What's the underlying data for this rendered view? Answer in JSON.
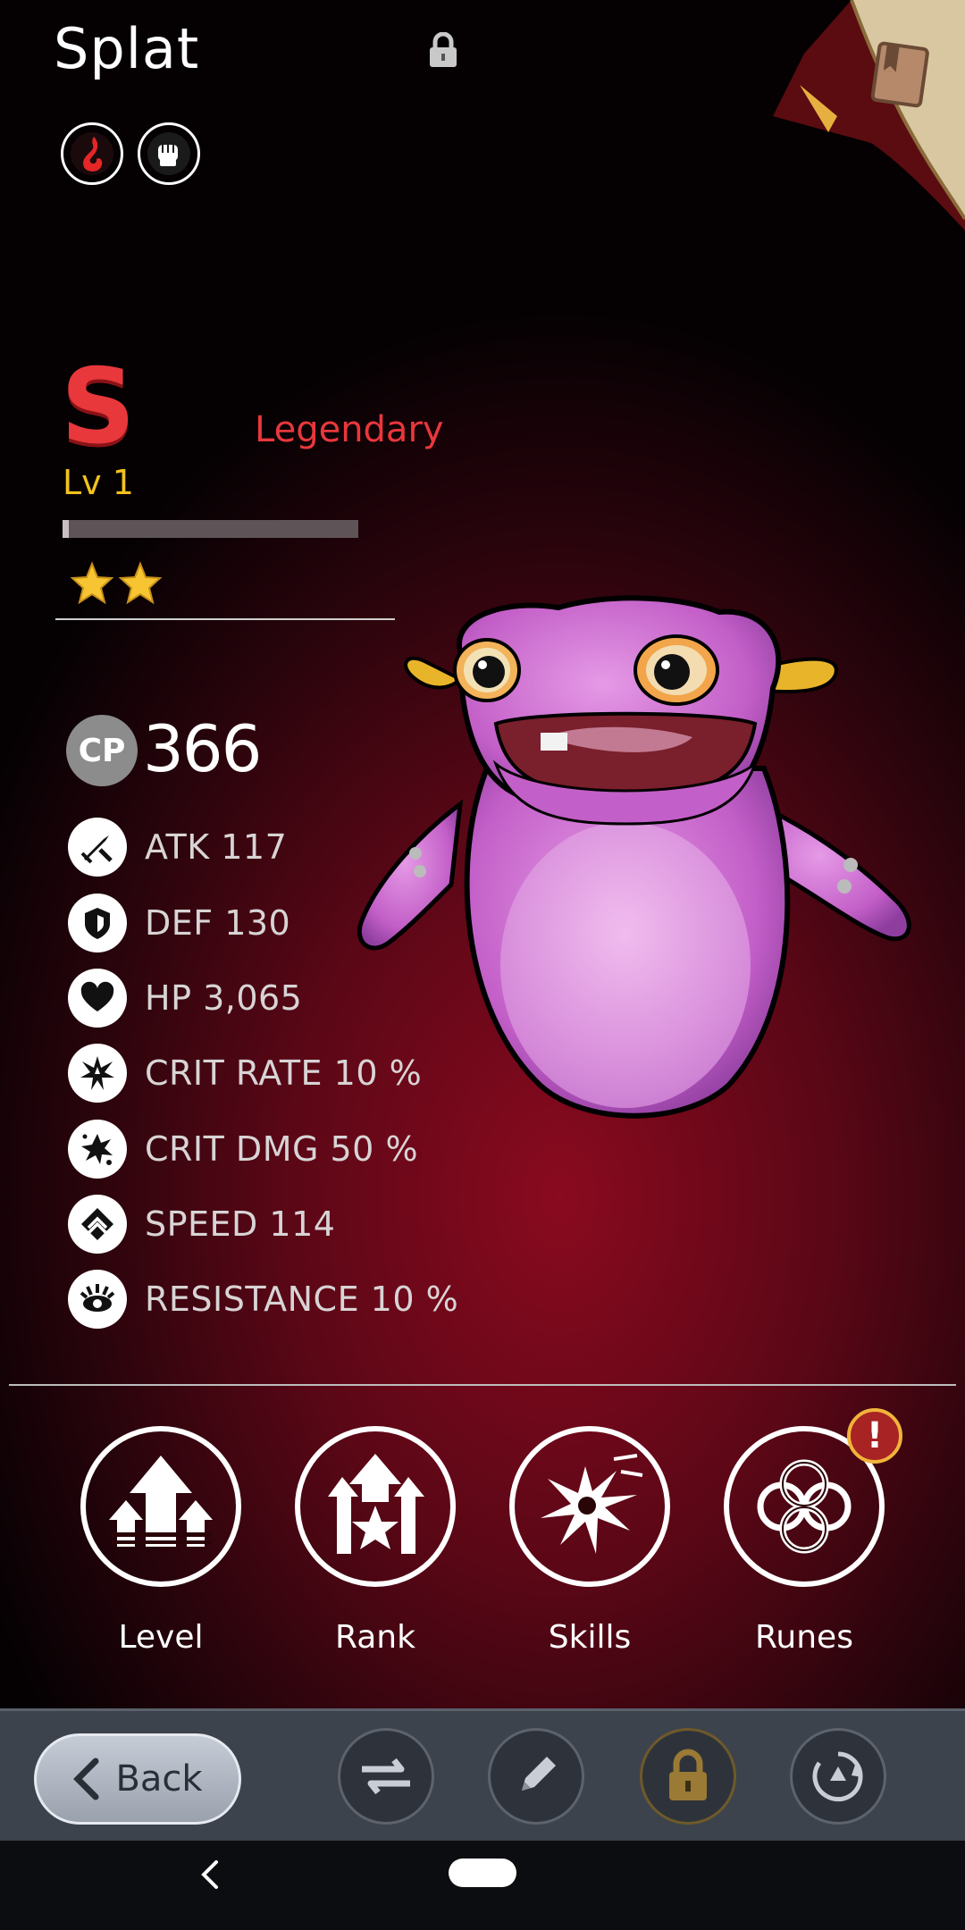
{
  "header": {
    "monster_name": "Splat",
    "element_icons": [
      "fire-element-icon",
      "fist-attack-type-icon"
    ],
    "lock_icon": "lock-icon",
    "book_icon": "book-icon"
  },
  "grade": {
    "letter": "S",
    "rarity": "Legendary",
    "level": "Lv 1",
    "xp_progress": 0.02,
    "stars": 2,
    "colors": {
      "grade": "#e8383c",
      "level": "#f2c21b"
    }
  },
  "cp": {
    "badge": "CP",
    "value": "366"
  },
  "stats": [
    {
      "icon": "sword-icon",
      "text": "ATK 117"
    },
    {
      "icon": "shield-icon",
      "text": "DEF 130"
    },
    {
      "icon": "heart-icon",
      "text": "HP 3,065"
    },
    {
      "icon": "crit-rate-icon",
      "text": "CRIT RATE 10 %"
    },
    {
      "icon": "crit-dmg-icon",
      "text": "CRIT DMG 50 %"
    },
    {
      "icon": "speed-icon",
      "text": "SPEED 114"
    },
    {
      "icon": "resistance-icon",
      "text": "RESISTANCE 10 %"
    }
  ],
  "actions": [
    {
      "icon": "level-up-icon",
      "label": "Level"
    },
    {
      "icon": "rank-up-icon",
      "label": "Rank"
    },
    {
      "icon": "skills-icon",
      "label": "Skills"
    },
    {
      "icon": "runes-icon",
      "label": "Runes",
      "alert": "!"
    }
  ],
  "toolbar": {
    "back_label": "Back",
    "tools": [
      "swap-icon",
      "edit-icon",
      "lock-icon",
      "recycle-icon"
    ]
  }
}
